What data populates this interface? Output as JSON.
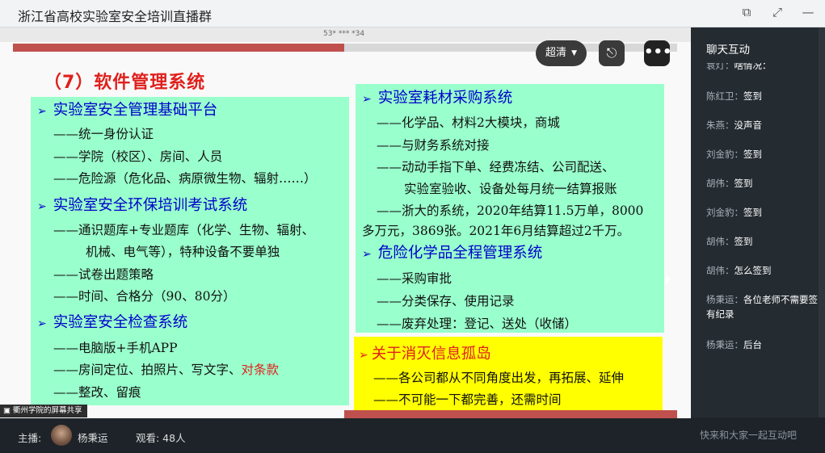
{
  "window": {
    "title": "浙江省高校实验室安全培训直播群"
  },
  "video": {
    "top_caption": "53* *** *34",
    "quality_label": "超清",
    "share_overlay": "衢州学院的屏幕共享"
  },
  "slide": {
    "heading": "（7）软件管理系统",
    "left": [
      {
        "type": "h",
        "text": "实验室安全管理基础平台"
      },
      {
        "type": "l",
        "text": "——统一身份认证"
      },
      {
        "type": "l",
        "text": "——学院（校区）、房间、人员"
      },
      {
        "type": "l",
        "text": "——危险源（危化品、病原微生物、辐射……）"
      },
      {
        "type": "h",
        "text": "实验室安全环保培训考试系统"
      },
      {
        "type": "l",
        "text": "——通识题库+专业题库（化学、生物、辐射、"
      },
      {
        "type": "l",
        "text": "机械、电气等），特种设备不要单独"
      },
      {
        "type": "l",
        "text": "——试卷出题策略"
      },
      {
        "type": "l",
        "text": "——时间、合格分（90、80分）"
      },
      {
        "type": "h",
        "text": "实验室安全检查系统"
      },
      {
        "type": "l",
        "text": "——电脑版+手机APP"
      },
      {
        "type": "l",
        "text": "——房间定位、拍照片、写文字、"
      },
      {
        "type": "l",
        "text": "——整改、留痕"
      }
    ],
    "left_red": "对条款",
    "right": [
      {
        "type": "h",
        "text": "实验室耗材采购系统"
      },
      {
        "type": "l",
        "text": "——化学品、材料2大模块，商城"
      },
      {
        "type": "l",
        "text": "——与财务系统对接"
      },
      {
        "type": "l",
        "text": "——动动手指下单、经费冻结、公司配送、"
      },
      {
        "type": "l",
        "text": "实验室验收、设备处每月统一结算报账"
      },
      {
        "type": "l",
        "text": "——浙大的系统，2020年结算11.5万单，8000"
      },
      {
        "type": "l",
        "text": "多万元，3869张。2021年6月结算超过2千万。"
      },
      {
        "type": "h",
        "text": "危险化学品全程管理系统"
      },
      {
        "type": "l",
        "text": "——采购审批"
      },
      {
        "type": "l",
        "text": "——分类保存、使用记录"
      },
      {
        "type": "l",
        "text": "——废弃处理：登记、送处（收储）"
      }
    ],
    "yellow": {
      "heading": "关于消灭信息孤岛",
      "lines": [
        "——各公司都从不同角度出发，再拓展、延伸",
        "——不可能一下都完善，还需时间"
      ]
    }
  },
  "footer": {
    "host_label": "主播:",
    "host_name": "杨秉运",
    "viewers_label": "观看: 48人"
  },
  "chat": {
    "title": "聊天互动",
    "messages": [
      {
        "who": "袁灯：",
        "text": "啥情况："
      },
      {
        "who": "陈红卫：",
        "text": "签到"
      },
      {
        "who": "朱燕：",
        "text": "没声音"
      },
      {
        "who": "刘金豹：",
        "text": "签到"
      },
      {
        "who": "胡伟：",
        "text": "签到"
      },
      {
        "who": "刘金豹：",
        "text": "签到"
      },
      {
        "who": "胡伟：",
        "text": "签到"
      },
      {
        "who": "胡伟：",
        "text": "怎么签到"
      },
      {
        "who": "杨秉运：",
        "text": "各位老师不需要签有纪录"
      },
      {
        "who": "杨秉运：",
        "text": "后台"
      }
    ],
    "input_placeholder": "快来和大家一起互动吧"
  }
}
